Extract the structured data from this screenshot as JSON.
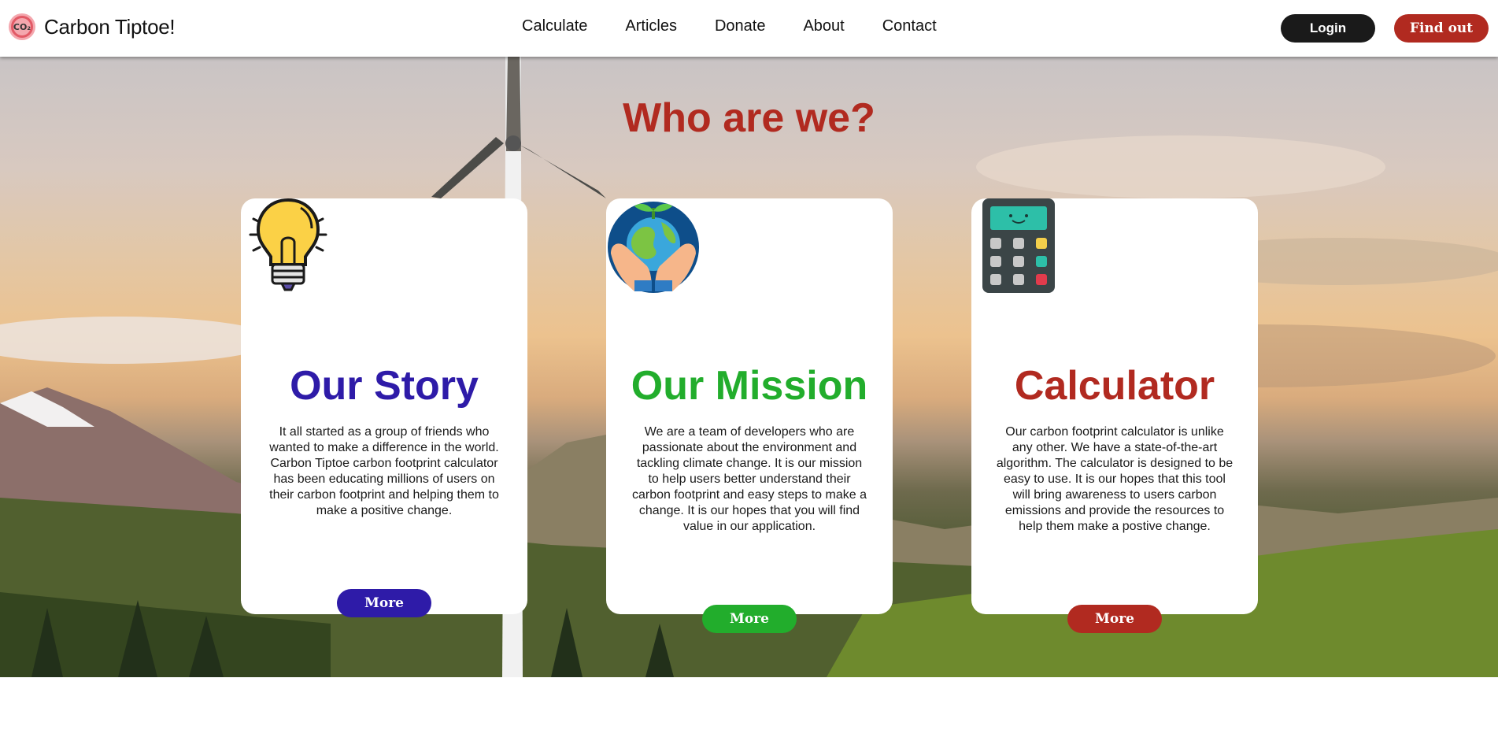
{
  "brand": {
    "name": "Carbon Tiptoe!",
    "logo_text": "CO₂",
    "logo_icon": "co2-logo-icon"
  },
  "nav": {
    "links": [
      {
        "label": "Calculate"
      },
      {
        "label": "Articles"
      },
      {
        "label": "Donate"
      },
      {
        "label": "About"
      },
      {
        "label": "Contact"
      }
    ],
    "login_label": "Login",
    "find_out_label": "Find out"
  },
  "hero": {
    "title": "Who are we?"
  },
  "cards": [
    {
      "icon": "lightbulb-icon",
      "title": "Our Story",
      "text": "It all started as a group of friends who wanted to make a difference in the world. Carbon Tiptoe carbon footprint calculator has been educating millions of users on their carbon footprint and helping them to make a positive change.",
      "button": "More",
      "color": "#2e1ba8"
    },
    {
      "icon": "earth-in-hands-icon",
      "title": "Our Mission",
      "text": "We are a team of developers who are passionate about the environment and tackling climate change. It is our mission to help users better understand their carbon footprint and easy steps to make a change. It is our hopes that you will find value in our application.",
      "button": "More",
      "color": "#22ad2c"
    },
    {
      "icon": "calculator-icon",
      "title": "Calculator",
      "text": "Our carbon footprint calculator is unlike any other. We have a state-of-the-art algorithm. The calculator is designed to be easy to use. It is our hopes that this tool will bring awareness to users carbon emissions and provide the resources to help them make a postive change.",
      "button": "More",
      "color": "#b12a20"
    }
  ],
  "colors": {
    "accent_red": "#b12a20",
    "accent_blue": "#2e1ba8",
    "accent_green": "#22ad2c",
    "dark": "#1a1a1a"
  }
}
